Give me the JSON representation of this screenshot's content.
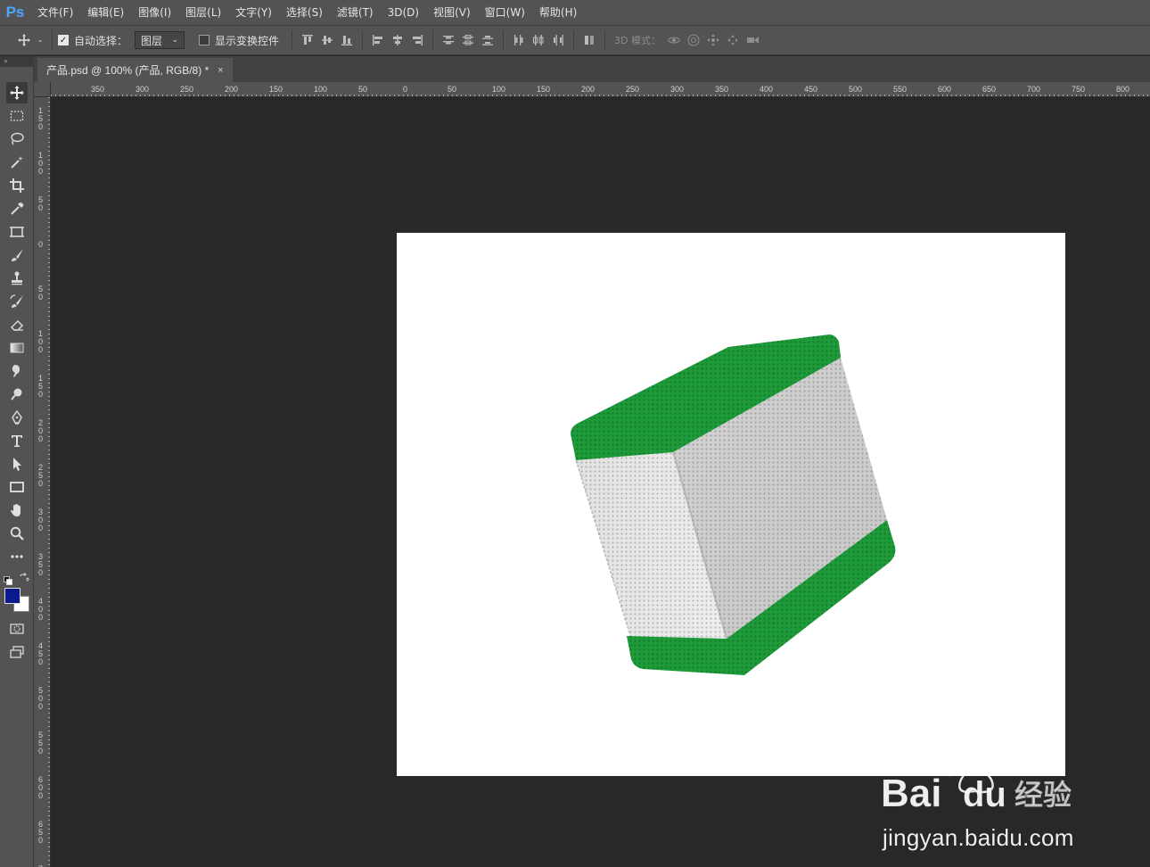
{
  "app": {
    "logo": "Ps",
    "menu": [
      "文件(F)",
      "编辑(E)",
      "图像(I)",
      "图层(L)",
      "文字(Y)",
      "选择(S)",
      "滤镜(T)",
      "3D(D)",
      "视图(V)",
      "窗口(W)",
      "帮助(H)"
    ]
  },
  "options": {
    "auto_select_label": "自动选择：",
    "auto_select_checked": true,
    "auto_select_target": "图层",
    "show_transform_label": "显示变换控件",
    "show_transform_checked": false,
    "mode_3d_label": "3D 模式："
  },
  "document": {
    "tab_title": "产品.psd @ 100% (产品, RGB/8) *",
    "close_symbol": "×"
  },
  "rulers": {
    "horizontal": [
      "350",
      "300",
      "250",
      "200",
      "150",
      "100",
      "50",
      "0",
      "50",
      "100",
      "150",
      "200",
      "250",
      "300",
      "350",
      "400",
      "450",
      "500",
      "550",
      "600",
      "650",
      "700",
      "750",
      "800"
    ],
    "vertical": [
      "150",
      "100",
      "50",
      "0",
      "50",
      "100",
      "150",
      "200",
      "250",
      "300",
      "350",
      "400",
      "450",
      "500",
      "550",
      "600",
      "650",
      "7"
    ]
  },
  "colors": {
    "foreground": "#0a1a8c",
    "background": "#ffffff",
    "box_green": "#1e9a3a",
    "box_face": "#d4d4d4"
  },
  "watermark": {
    "brand": "Bai du 经验",
    "url": "jingyan.baidu.com"
  }
}
